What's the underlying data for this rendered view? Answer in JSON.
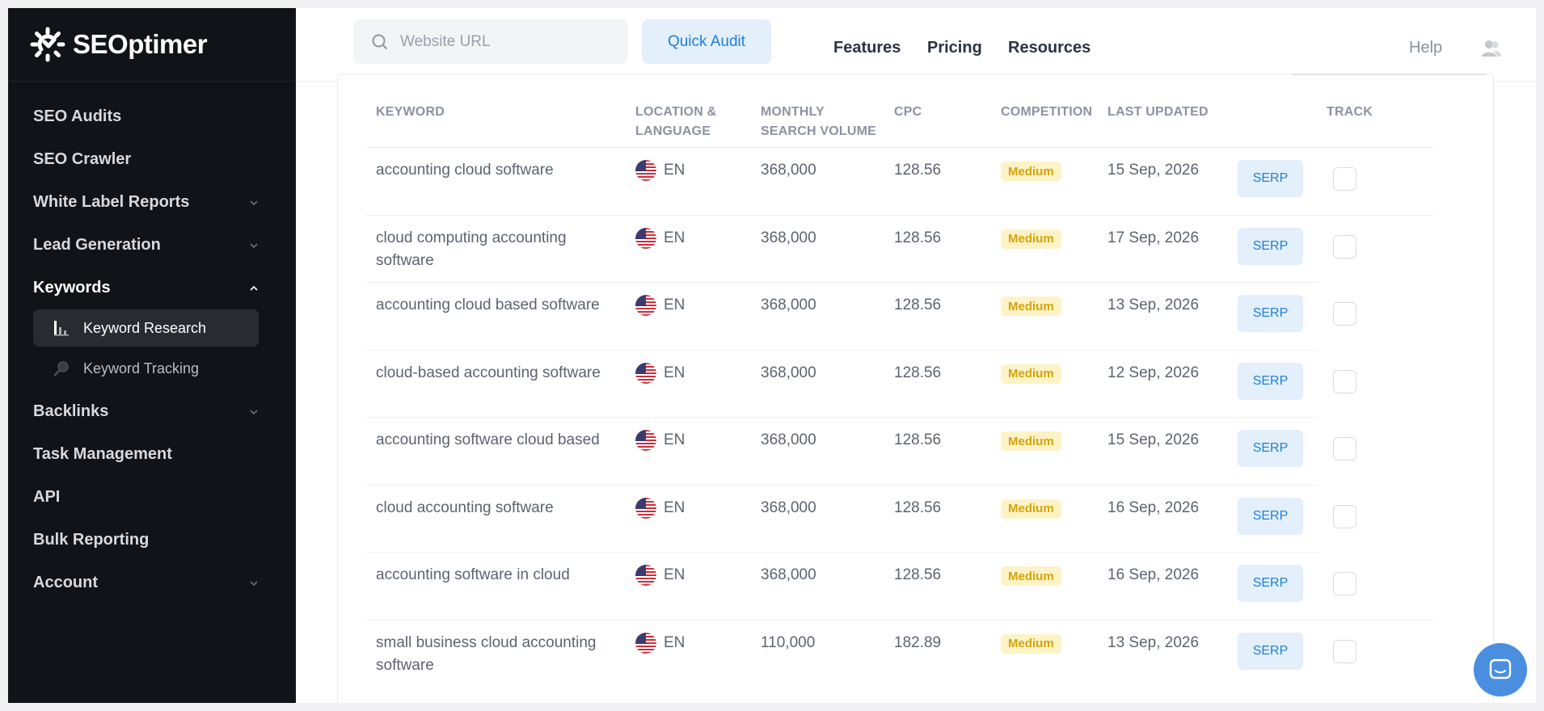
{
  "brand": {
    "name": "SEOptimer"
  },
  "sidebar": {
    "items": [
      {
        "label": "SEO Audits"
      },
      {
        "label": "SEO Crawler"
      },
      {
        "label": "White Label Reports"
      },
      {
        "label": "Lead Generation"
      },
      {
        "label": "Keywords"
      },
      {
        "label": "Backlinks"
      },
      {
        "label": "Task Management"
      },
      {
        "label": "API"
      },
      {
        "label": "Bulk Reporting"
      },
      {
        "label": "Account"
      }
    ],
    "keywords_sub": [
      {
        "label": "Keyword Research",
        "icon": "bar-chart-icon"
      },
      {
        "label": "Keyword Tracking",
        "icon": "magnifier-icon"
      }
    ]
  },
  "header": {
    "search_placeholder": "Website URL",
    "quick_audit_label": "Quick Audit",
    "nav": [
      "Features",
      "Pricing",
      "Resources"
    ],
    "help_label": "Help"
  },
  "table": {
    "headers": {
      "keyword": "KEYWORD",
      "location_1": "LOCATION &",
      "location_2": "LANGUAGE",
      "volume_1": "MONTHLY",
      "volume_2": "SEARCH VOLUME",
      "cpc": "CPC",
      "competition": "COMPETITION",
      "last_updated": "LAST UPDATED",
      "track": "TRACK"
    },
    "rows": [
      {
        "keyword": "accounting cloud software",
        "lang": "EN",
        "volume": "368,000",
        "cpc": "128.56",
        "competition": "Medium",
        "date": "15 Sep, 2026",
        "serp": "SERP"
      },
      {
        "keyword": "cloud computing accounting software",
        "lang": "EN",
        "volume": "368,000",
        "cpc": "128.56",
        "competition": "Medium",
        "date": "17 Sep, 2026",
        "serp": "SERP"
      },
      {
        "keyword": "accounting cloud based software",
        "lang": "EN",
        "volume": "368,000",
        "cpc": "128.56",
        "competition": "Medium",
        "date": "13 Sep, 2026",
        "serp": "SERP"
      },
      {
        "keyword": "cloud-based accounting software",
        "lang": "EN",
        "volume": "368,000",
        "cpc": "128.56",
        "competition": "Medium",
        "date": "12 Sep, 2026",
        "serp": "SERP"
      },
      {
        "keyword": "accounting software cloud based",
        "lang": "EN",
        "volume": "368,000",
        "cpc": "128.56",
        "competition": "Medium",
        "date": "15 Sep, 2026",
        "serp": "SERP"
      },
      {
        "keyword": "cloud accounting software",
        "lang": "EN",
        "volume": "368,000",
        "cpc": "128.56",
        "competition": "Medium",
        "date": "16 Sep, 2026",
        "serp": "SERP"
      },
      {
        "keyword": "accounting software in cloud",
        "lang": "EN",
        "volume": "368,000",
        "cpc": "128.56",
        "competition": "Medium",
        "date": "16 Sep, 2026",
        "serp": "SERP"
      },
      {
        "keyword": "small business cloud accounting software",
        "lang": "EN",
        "volume": "110,000",
        "cpc": "182.89",
        "competition": "Medium",
        "date": "13 Sep, 2026",
        "serp": "SERP"
      }
    ]
  },
  "colors": {
    "sidebar_bg": "#121318",
    "accent": "#1f7fd8",
    "accent_bg": "#e3effb",
    "badge_bg": "#fdf3c6",
    "badge_text": "#d4a30a"
  }
}
